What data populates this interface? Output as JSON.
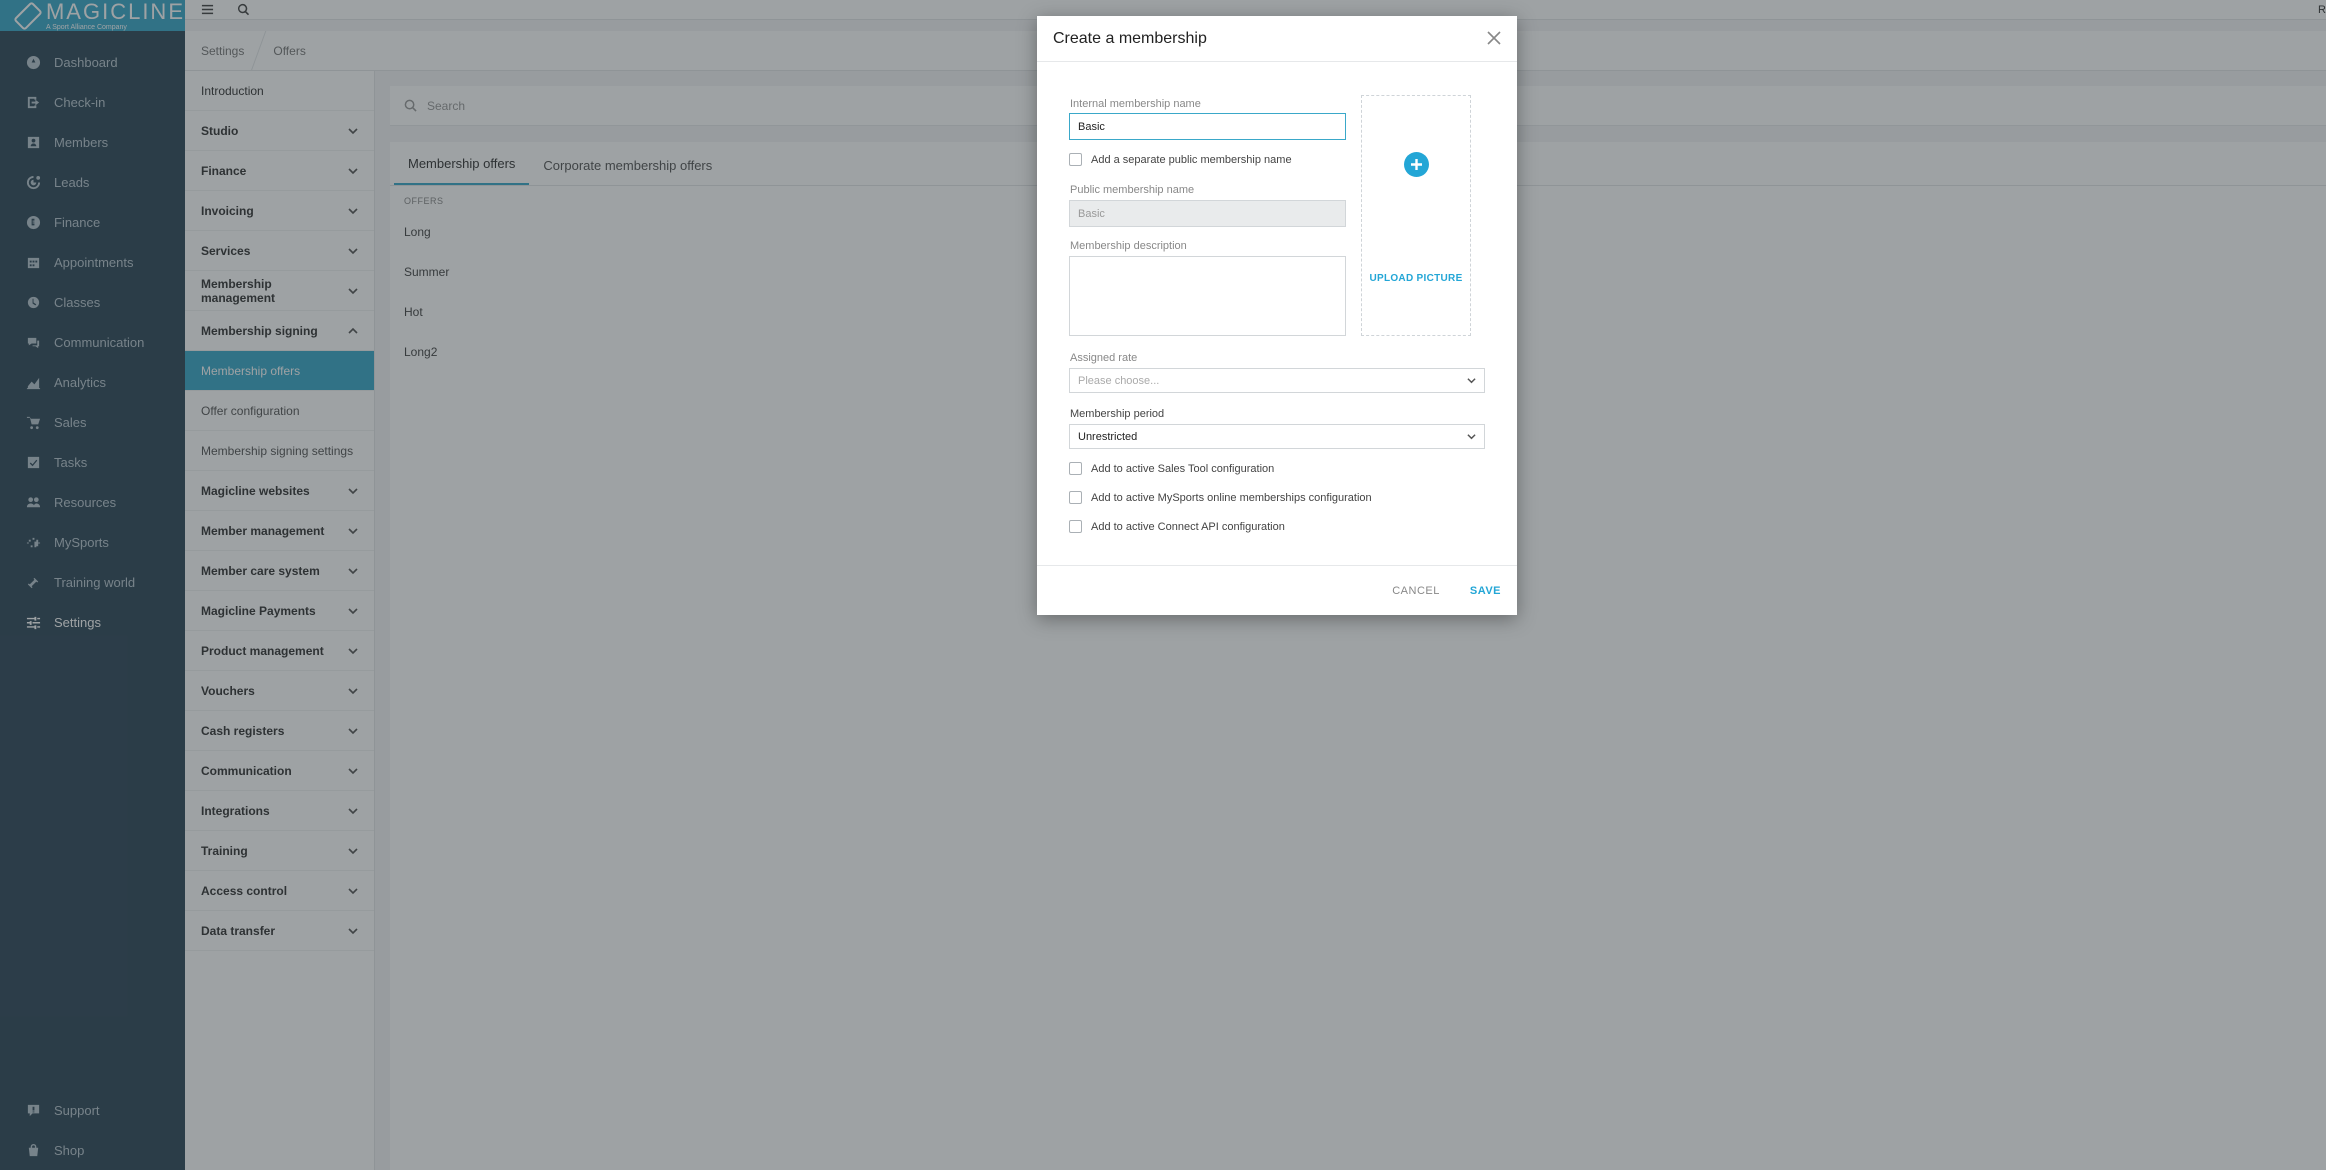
{
  "brand": {
    "name": "MAGICLINE",
    "tagline": "A Sport Alliance Company",
    "accent": "#3aa8c9"
  },
  "nav": {
    "items": [
      {
        "label": "Dashboard",
        "icon": "dashboard-icon"
      },
      {
        "label": "Check-in",
        "icon": "check-in-icon"
      },
      {
        "label": "Members",
        "icon": "members-icon"
      },
      {
        "label": "Leads",
        "icon": "leads-icon"
      },
      {
        "label": "Finance",
        "icon": "finance-icon"
      },
      {
        "label": "Appointments",
        "icon": "calendar-icon"
      },
      {
        "label": "Classes",
        "icon": "classes-icon"
      },
      {
        "label": "Communication",
        "icon": "chat-icon"
      },
      {
        "label": "Analytics",
        "icon": "analytics-icon"
      },
      {
        "label": "Sales",
        "icon": "cart-icon"
      },
      {
        "label": "Tasks",
        "icon": "tasks-icon"
      },
      {
        "label": "Resources",
        "icon": "resources-icon"
      },
      {
        "label": "MySports",
        "icon": "mysports-icon"
      },
      {
        "label": "Training world",
        "icon": "dumbbell-icon"
      },
      {
        "label": "Settings",
        "icon": "settings-icon",
        "active": true
      }
    ],
    "bottom": [
      {
        "label": "Support",
        "icon": "support-icon"
      },
      {
        "label": "Shop",
        "icon": "shop-icon"
      }
    ]
  },
  "topbar": {
    "menu_icon": "hamburger-icon",
    "search_icon": "search-icon",
    "right_letter": "R"
  },
  "breadcrumb": {
    "items": [
      "Settings",
      "Offers"
    ]
  },
  "submenu": {
    "items": [
      {
        "label": "Introduction",
        "bold": false,
        "chevron": false
      },
      {
        "label": "Studio",
        "bold": true,
        "chevron": "down"
      },
      {
        "label": "Finance",
        "bold": true,
        "chevron": "down"
      },
      {
        "label": "Invoicing",
        "bold": true,
        "chevron": "down"
      },
      {
        "label": "Services",
        "bold": true,
        "chevron": "down"
      },
      {
        "label": "Membership management",
        "bold": true,
        "chevron": "down"
      },
      {
        "label": "Membership signing",
        "bold": true,
        "chevron": "up"
      },
      {
        "label": "Membership offers",
        "child": true,
        "selected": true
      },
      {
        "label": "Offer configuration",
        "child": true
      },
      {
        "label": "Membership signing settings",
        "child": true
      },
      {
        "label": "Magicline websites",
        "bold": true,
        "chevron": "down"
      },
      {
        "label": "Member management",
        "bold": true,
        "chevron": "down"
      },
      {
        "label": "Member care system",
        "bold": true,
        "chevron": "down"
      },
      {
        "label": "Magicline Payments",
        "bold": true,
        "chevron": "down"
      },
      {
        "label": "Product management",
        "bold": true,
        "chevron": "down"
      },
      {
        "label": "Vouchers",
        "bold": true,
        "chevron": "down"
      },
      {
        "label": "Cash registers",
        "bold": true,
        "chevron": "down"
      },
      {
        "label": "Communication",
        "bold": true,
        "chevron": "down"
      },
      {
        "label": "Integrations",
        "bold": true,
        "chevron": "down"
      },
      {
        "label": "Training",
        "bold": true,
        "chevron": "down"
      },
      {
        "label": "Access control",
        "bold": true,
        "chevron": "down"
      },
      {
        "label": "Data transfer",
        "bold": true,
        "chevron": "down"
      }
    ]
  },
  "main": {
    "search_placeholder": "Search",
    "tabs": [
      {
        "label": "Membership offers",
        "active": true
      },
      {
        "label": "Corporate membership offers",
        "active": false
      }
    ],
    "offers_header": "OFFERS",
    "offers": [
      "Long",
      "Summer",
      "Hot",
      "Long2"
    ]
  },
  "modal": {
    "title": "Create a membership",
    "internal_name_label": "Internal membership name",
    "internal_name_value": "Basic",
    "separate_public_name_label": "Add a separate public membership name",
    "public_name_label": "Public membership name",
    "public_name_value": "Basic",
    "description_label": "Membership description",
    "description_value": "",
    "upload_label": "UPLOAD PICTURE",
    "assigned_rate_label": "Assigned rate",
    "assigned_rate_placeholder": "Please choose...",
    "period_label": "Membership period",
    "period_value": "Unrestricted",
    "checkboxes": [
      "Add to active Sales Tool configuration",
      "Add to active MySports online memberships configuration",
      "Add to active Connect API configuration"
    ],
    "cancel_label": "CANCEL",
    "save_label": "SAVE"
  }
}
